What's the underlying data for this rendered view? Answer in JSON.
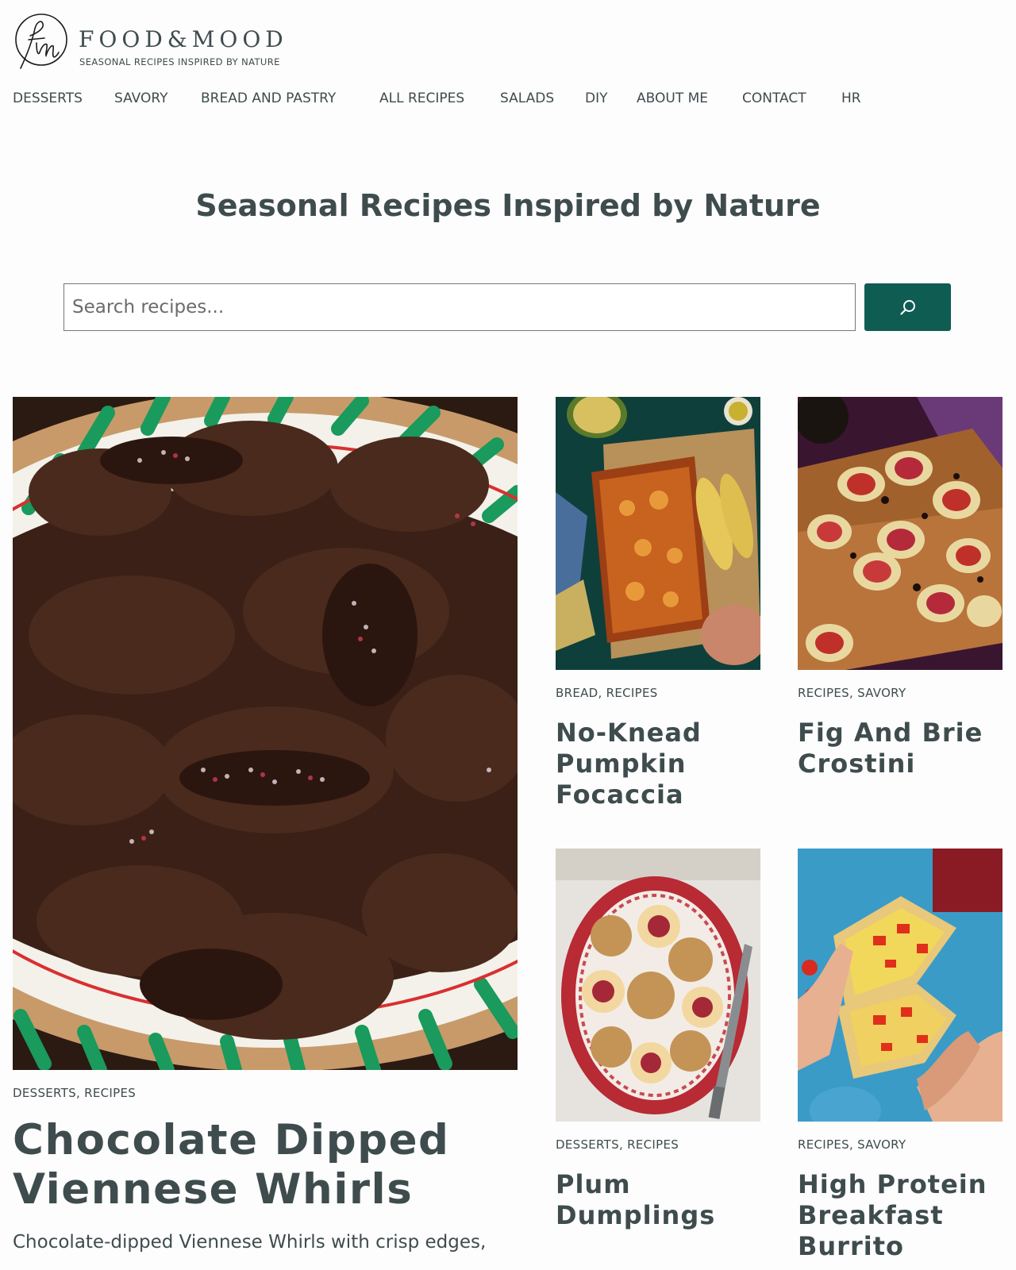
{
  "header": {
    "logo_title": "FOOD&MOOD",
    "logo_tagline": "SEASONAL RECIPES INSPIRED BY NATURE"
  },
  "nav": {
    "items": [
      {
        "label": "DESSERTS"
      },
      {
        "label": "SAVORY"
      },
      {
        "label": "BREAD AND PASTRY"
      },
      {
        "label": "ALL RECIPES"
      },
      {
        "label": "SALADS"
      },
      {
        "label": "DIY"
      },
      {
        "label": "ABOUT ME"
      },
      {
        "label": "CONTACT"
      },
      {
        "label": "HR"
      }
    ]
  },
  "hero": {
    "title": "Seasonal Recipes Inspired by Nature"
  },
  "search": {
    "placeholder": "Search recipes...",
    "value": "",
    "button_icon": "search-icon"
  },
  "featured": {
    "categories": "DESSERTS, RECIPES",
    "title": "Chocolate Dipped Viennese Whirls",
    "excerpt": "Chocolate-dipped Viennese Whirls with crisp edges,",
    "image": "chocolate-viennese-whirls-photo"
  },
  "recipes": [
    {
      "categories": "BREAD, RECIPES",
      "title": "No-Knead Pumpkin Focaccia",
      "image": "pumpkin-focaccia-photo"
    },
    {
      "categories": "RECIPES, SAVORY",
      "title": "Fig And Brie Crostini",
      "image": "fig-brie-crostini-photo"
    },
    {
      "categories": "DESSERTS, RECIPES",
      "title": "Plum Dumplings",
      "image": "plum-dumplings-photo"
    },
    {
      "categories": "RECIPES, SAVORY",
      "title": "High Protein Breakfast Burrito",
      "image": "breakfast-burrito-photo"
    }
  ],
  "colors": {
    "text": "#3f4c4d",
    "accent": "#0f5c52",
    "background": "#fdfdfd"
  }
}
